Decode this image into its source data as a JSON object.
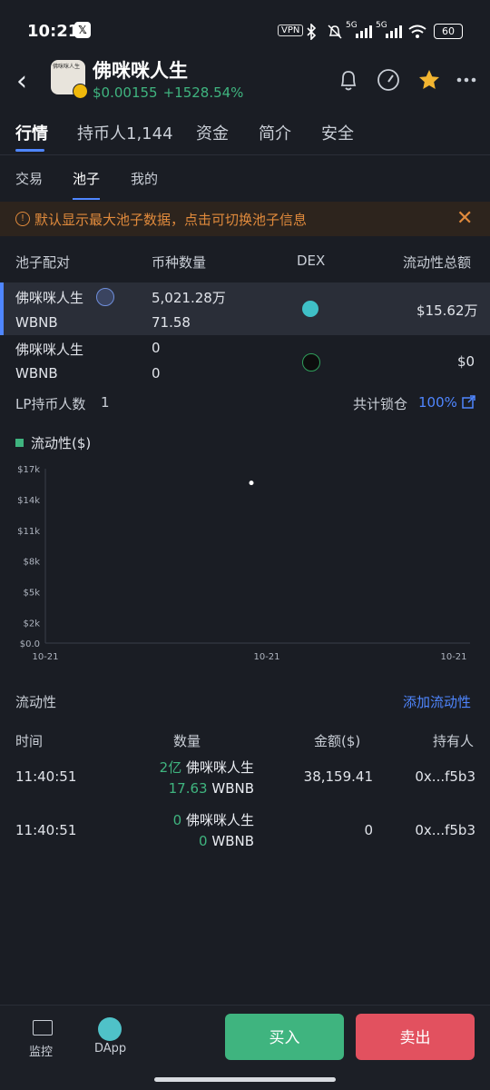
{
  "status_bar": {
    "time": "10:21",
    "vpn": "VPN",
    "battery": "60",
    "signal1": "5G",
    "signal2": "5G"
  },
  "header": {
    "title": "佛咪咪人生",
    "price": "$0.00155",
    "change": "+1528.54%",
    "avatar_text": "佛咪咪人生"
  },
  "main_tabs": [
    {
      "label": "行情"
    },
    {
      "label": "持币人1,144"
    },
    {
      "label": "资金"
    },
    {
      "label": "简介"
    },
    {
      "label": "安全"
    }
  ],
  "sub_tabs": [
    {
      "label": "交易"
    },
    {
      "label": "池子"
    },
    {
      "label": "我的"
    }
  ],
  "notice": {
    "text": "默认显示最大池子数据，点击可切换池子信息"
  },
  "pool_table": {
    "headers": [
      "池子配对",
      "币种数量",
      "DEX",
      "流动性总额"
    ],
    "rows": [
      {
        "token": "佛咪咪人生",
        "base": "WBNB",
        "amount1": "5,021.28万",
        "amount2": "71.58",
        "total": "$15.62万"
      },
      {
        "token": "佛咪咪人生",
        "base": "WBNB",
        "amount1": "0",
        "amount2": "0",
        "total": "$0"
      }
    ]
  },
  "lp": {
    "label": "LP持币人数",
    "count": "1",
    "lock_label": "共计锁仓",
    "lock_pct": "100%"
  },
  "chart_data": {
    "type": "line",
    "title": "",
    "legend": [
      "流动性($)"
    ],
    "series": [
      {
        "name": "流动性($)",
        "x": [
          "10-21"
        ],
        "values": [
          15620
        ]
      }
    ],
    "y_ticks": [
      "$0.0",
      "$2k",
      "$5k",
      "$8k",
      "$11k",
      "$14k",
      "$17k"
    ],
    "x_ticks": [
      "10-21",
      "10-21",
      "10-21"
    ],
    "ylim": [
      0,
      17000
    ],
    "colors": {
      "line": "#3fb47f",
      "point": "#ffffff"
    }
  },
  "liquidity": {
    "title": "流动性",
    "add_label": "添加流动性",
    "headers": [
      "时间",
      "数量",
      "金额($)",
      "持有人"
    ],
    "rows": [
      {
        "time": "11:40:51",
        "qty1": "2亿",
        "token1": "佛咪咪人生",
        "qty2": "17.63",
        "token2": "WBNB",
        "amount": "38,159.41",
        "holder": "0x...f5b3"
      },
      {
        "time": "11:40:51",
        "qty1": "0",
        "token1": "佛咪咪人生",
        "qty2": "0",
        "token2": "WBNB",
        "amount": "0",
        "holder": "0x...f5b3"
      }
    ]
  },
  "bottom_nav": {
    "monitor": "监控",
    "dapp": "DApp",
    "buy": "买入",
    "sell": "卖出"
  },
  "colors": {
    "accent": "#4f86ff",
    "up": "#3fb47f",
    "down": "#e2515f",
    "warning": "#e08a3c"
  }
}
